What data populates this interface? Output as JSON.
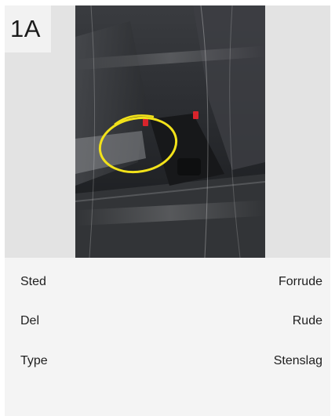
{
  "damage": {
    "id": "1A",
    "photo_icon": "photo-image",
    "fields": [
      {
        "label": "Sted",
        "value": "Forrude"
      },
      {
        "label": "Del",
        "value": "Rude"
      },
      {
        "label": "Type",
        "value": "Stenslag"
      }
    ]
  },
  "colors": {
    "highlight_circle": "#f2e21a",
    "marker_red": "#d8242c"
  }
}
